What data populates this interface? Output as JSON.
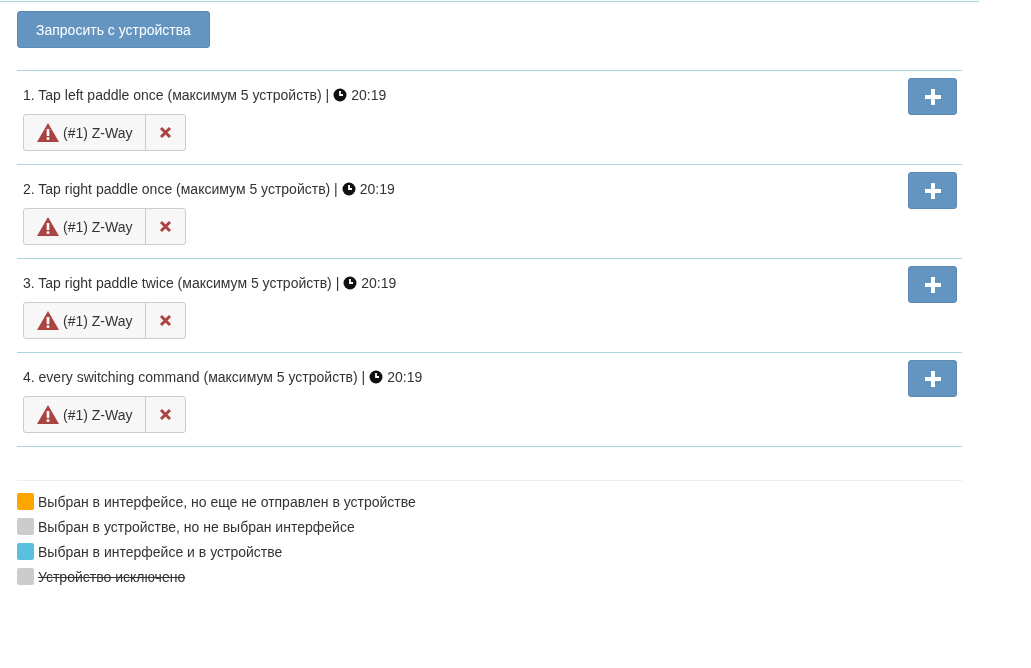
{
  "request_button": "Запросить с устройства",
  "groups": [
    {
      "title": "1. Tap left paddle once (максимум 5 устройств) |",
      "time": "20:19",
      "devices": [
        {
          "label": "(#1) Z-Way"
        }
      ]
    },
    {
      "title": "2. Tap right paddle once (максимум 5 устройств) |",
      "time": "20:19",
      "devices": [
        {
          "label": "(#1) Z-Way"
        }
      ]
    },
    {
      "title": "3. Tap right paddle twice (максимум 5 устройств) |",
      "time": "20:19",
      "devices": [
        {
          "label": "(#1) Z-Way"
        }
      ]
    },
    {
      "title": "4. every switching command (максимум 5 устройств) |",
      "time": "20:19",
      "devices": [
        {
          "label": "(#1) Z-Way"
        }
      ]
    }
  ],
  "legend": [
    {
      "label": "Выбран в интерфейсе, но еще не отправлен в устройстве",
      "color": "#ffa500",
      "struck": false
    },
    {
      "label": "Выбран в устройстве, но не выбран интерфейсе",
      "color": "#cccccc",
      "struck": false
    },
    {
      "label": "Выбран в интерфейсе и в устройстве",
      "color": "#5bc0de",
      "struck": false
    },
    {
      "label": "Устройство исключено",
      "color": "#cccccc",
      "struck": true
    }
  ]
}
